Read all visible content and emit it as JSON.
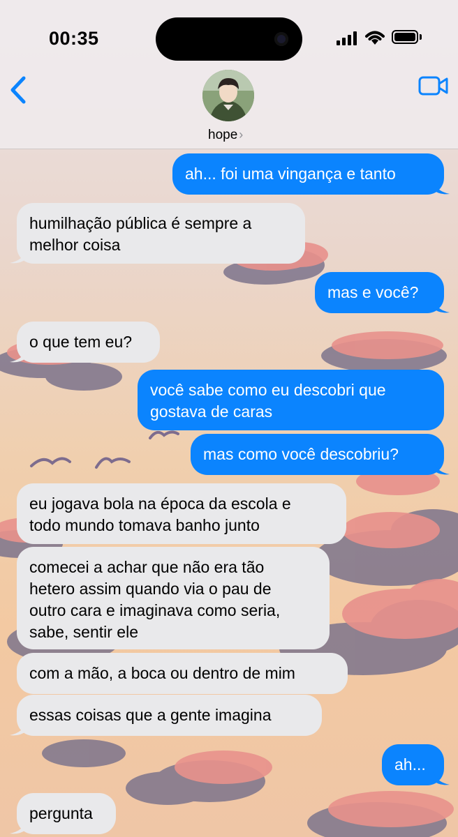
{
  "status_bar": {
    "time": "00:35"
  },
  "header": {
    "contact_name": "hope",
    "chevron": "›"
  },
  "colors": {
    "sent_bubble": "#0b84fe",
    "received_bubble": "#e9e9eb",
    "accent": "#0b84fe"
  },
  "messages": [
    {
      "from": "me",
      "text": "ah... foi uma vingança e tanto"
    },
    {
      "from": "them",
      "lines": [
        "humilhação pública é sempre a",
        "melhor coisa"
      ]
    },
    {
      "from": "me",
      "text": "mas e você?"
    },
    {
      "from": "them",
      "text": "o que tem eu?"
    },
    {
      "from": "me",
      "lines": [
        "você sabe como eu descobri que",
        "gostava de caras"
      ]
    },
    {
      "from": "me",
      "text": "mas como você descobriu?"
    },
    {
      "from": "them",
      "lines": [
        "eu jogava bola na época da escola e",
        "todo mundo tomava banho junto"
      ]
    },
    {
      "from": "them",
      "lines": [
        "comecei a achar que não era tão",
        "hetero assim quando via o pau de",
        "outro cara e imaginava como seria,",
        "sabe, sentir ele"
      ]
    },
    {
      "from": "them",
      "text": "com a mão, a boca ou dentro de mim"
    },
    {
      "from": "them",
      "text": "essas coisas que a gente imagina"
    },
    {
      "from": "me",
      "text": "ah..."
    },
    {
      "from": "them",
      "text": "pergunta"
    }
  ]
}
